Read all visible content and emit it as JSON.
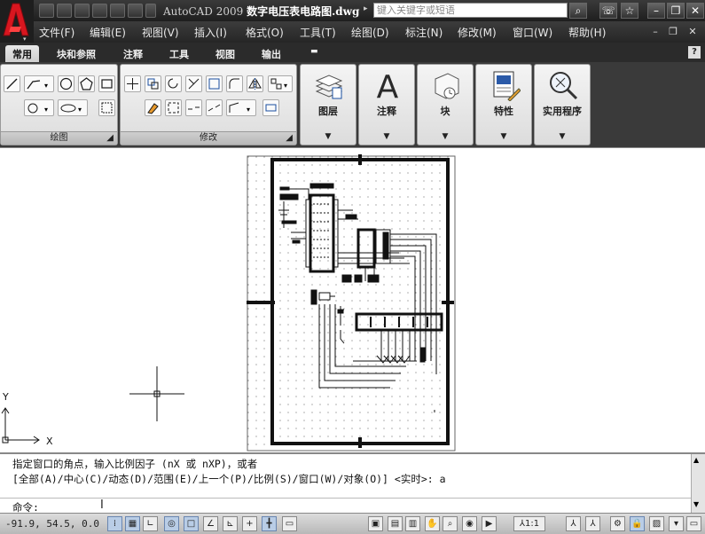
{
  "title_bar": {
    "app_name": "AutoCAD 2009",
    "file_name": "数字电压表电路图.dwg",
    "search_placeholder": "键入关键字或短语",
    "colors": {
      "bg": "#1e1e1e",
      "logo": "#d8161f"
    }
  },
  "menu": {
    "items": [
      "文件(F)",
      "编辑(E)",
      "视图(V)",
      "插入(I)",
      "格式(O)",
      "工具(T)",
      "绘图(D)",
      "标注(N)",
      "修改(M)",
      "窗口(W)",
      "帮助(H)"
    ]
  },
  "ribbon_tabs": {
    "items": [
      "常用",
      "块和参照",
      "注释",
      "工具",
      "视图",
      "输出"
    ],
    "active": "常用"
  },
  "ribbon_panels": {
    "draw": "绘图",
    "modify": "修改",
    "layers": "图层",
    "annotation": "注释",
    "block": "块",
    "properties": "特性",
    "utilities": "实用程序"
  },
  "ucs": {
    "x_label": "X",
    "y_label": "Y"
  },
  "command": {
    "line1": "指定窗口的角点，输入比例因子 (nX 或 nXP)，或者",
    "line2": "[全部(A)/中心(C)/动态(D)/范围(E)/上一个(P)/比例(S)/窗口(W)/对象(O)] <实时>: a",
    "prompt": "命令:"
  },
  "status": {
    "coordinates": "-91.9, 54.5, 0.0",
    "annotation_scale": "1:1"
  }
}
